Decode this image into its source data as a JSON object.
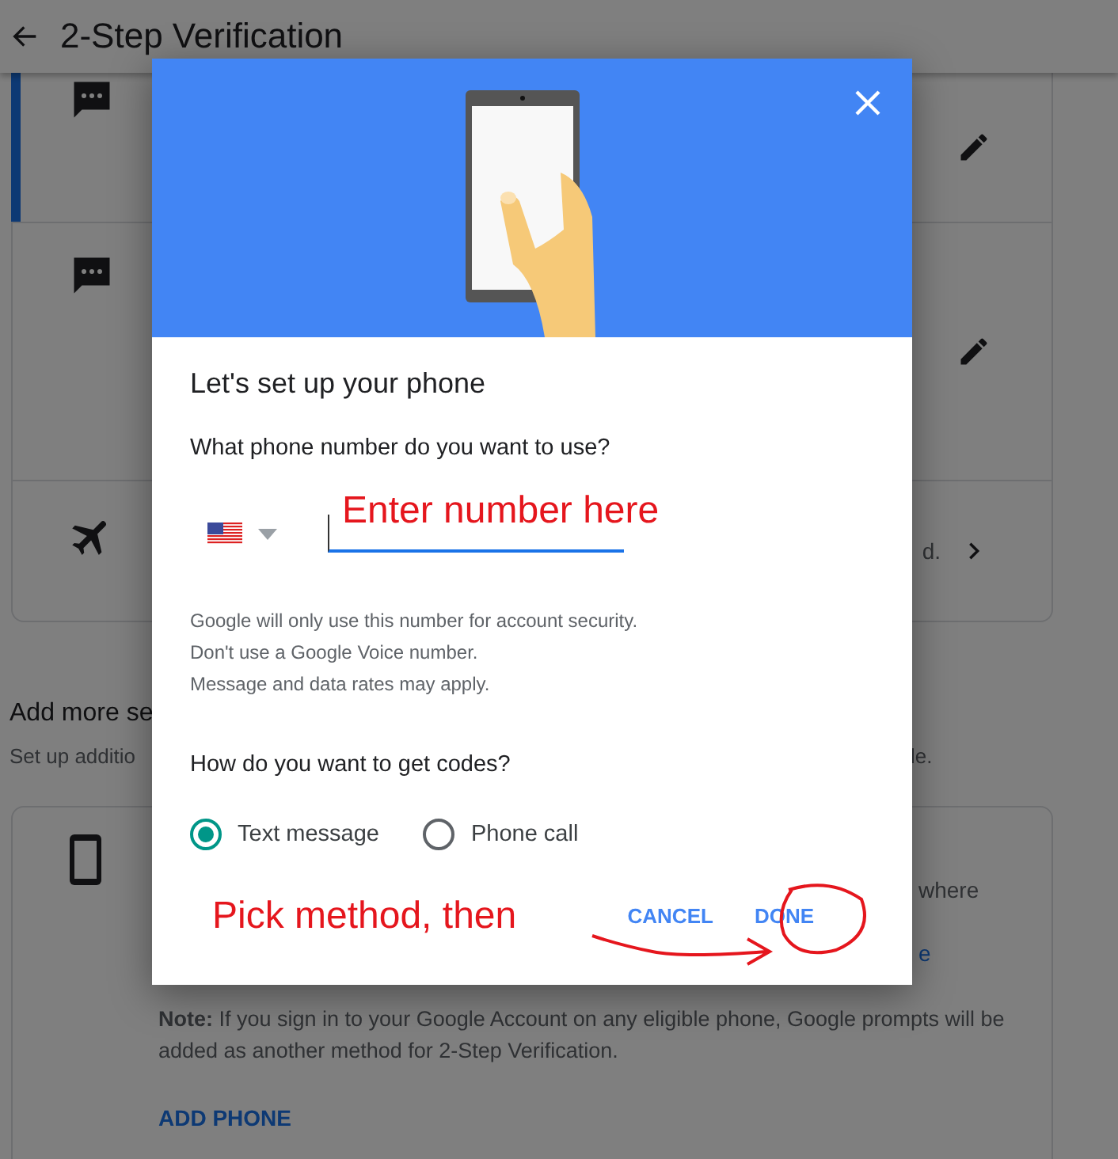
{
  "header": {
    "title": "2-Step Verification"
  },
  "methods_card": {
    "rows": [
      {
        "kind": "message",
        "selected": true
      },
      {
        "kind": "message",
        "selected": false
      },
      {
        "kind": "plane",
        "selected": false,
        "text_fragment": "d."
      }
    ]
  },
  "add_more": {
    "heading_fragment": "Add more se",
    "subtitle_fragment": "Set up additio",
    "subtitle_end_fragment": "le."
  },
  "phone_card": {
    "line_fragment": "where",
    "link_fragment": "e",
    "note": "**Note:** If you sign in to your Google Account on any eligible phone, Google prompts will be added as another method for 2-Step Verification.",
    "add_button": "ADD PHONE"
  },
  "dialog": {
    "title": "Let's set up your phone",
    "question": "What phone number do you want to use?",
    "info_lines": [
      "Google will only use this number for account security.",
      "Don't use a Google Voice number.",
      "Message and data rates may apply."
    ],
    "codes_question": "How do you want to get codes?",
    "methods": [
      {
        "label": "Text message",
        "selected": true
      },
      {
        "label": "Phone call",
        "selected": false
      }
    ],
    "buttons": [
      "CANCEL",
      "DONE"
    ]
  },
  "annotations": [
    {
      "text": "Enter number here"
    },
    {
      "text": "Pick method, then"
    }
  ]
}
